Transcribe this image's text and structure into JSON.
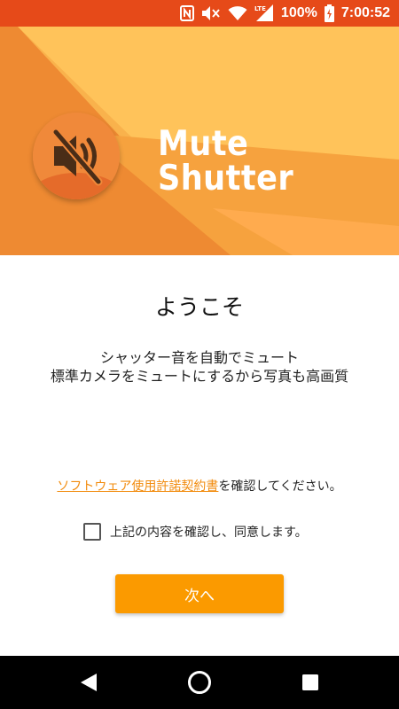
{
  "status_bar": {
    "battery_percent": "100%",
    "time": "7:00:52",
    "network_label": "LTE",
    "icons": [
      "nfc-icon",
      "mute-icon",
      "wifi-icon",
      "signal-icon",
      "battery-charging-icon"
    ],
    "bg_color": "#e64a19"
  },
  "hero": {
    "app_name": "Mute Shutter",
    "colors": {
      "primary": "#f9b24c",
      "light": "#ffc35a",
      "dark": "#ee8a32",
      "logo_bg": "#f0893a",
      "logo_icon": "#4a2d17"
    }
  },
  "welcome": {
    "title": "ようこそ",
    "desc_line1": "シャッター音を自動でミュート",
    "desc_line2": "標準カメラをミュートにするから写真も高画質"
  },
  "license": {
    "link_text": "ソフトウェア使用許諾契約書",
    "suffix_text": "を確認してください。",
    "agree_label": "上記の内容を確認し、同意します。",
    "agree_checked": false
  },
  "next_button": {
    "label": "次へ",
    "color": "#fb9a00"
  },
  "nav_bar": {
    "buttons": [
      "back-icon",
      "home-icon",
      "recents-icon"
    ]
  }
}
